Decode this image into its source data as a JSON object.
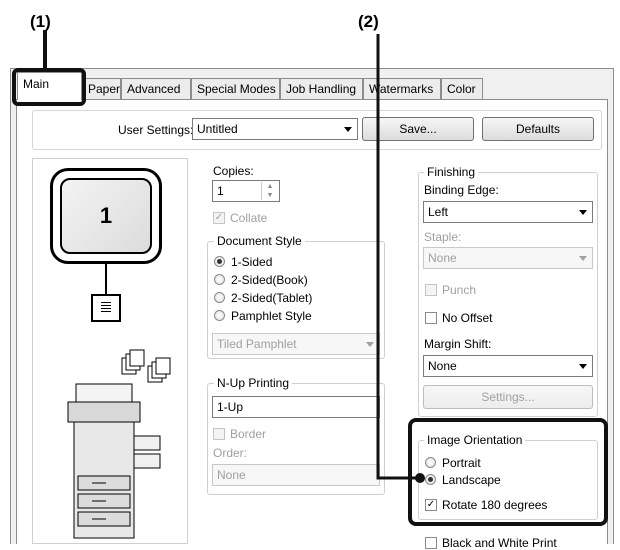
{
  "callouts": {
    "one": "(1)",
    "two": "(2)"
  },
  "tabs": [
    "Main",
    "Paper",
    "Advanced",
    "Special Modes",
    "Job Handling",
    "Watermarks",
    "Color"
  ],
  "user_settings": {
    "label": "User Settings:",
    "value": "Untitled",
    "save": "Save...",
    "defaults": "Defaults"
  },
  "preview": {
    "page_number": "1"
  },
  "copies": {
    "label": "Copies:",
    "value": "1",
    "collate": "Collate"
  },
  "document_style": {
    "legend": "Document Style",
    "options": [
      "1-Sided",
      "2-Sided(Book)",
      "2-Sided(Tablet)",
      "Pamphlet Style"
    ],
    "selected": "1-Sided",
    "pamphlet_value": "Tiled Pamphlet"
  },
  "nup": {
    "legend": "N-Up Printing",
    "value": "1-Up",
    "border": "Border",
    "order_label": "Order:",
    "order_value": "None"
  },
  "finishing": {
    "legend": "Finishing",
    "binding_label": "Binding Edge:",
    "binding_value": "Left",
    "staple_label": "Staple:",
    "staple_value": "None",
    "punch": "Punch",
    "no_offset": "No Offset",
    "margin_label": "Margin Shift:",
    "margin_value": "None",
    "settings": "Settings..."
  },
  "orientation": {
    "legend": "Image Orientation",
    "portrait": "Portrait",
    "landscape": "Landscape",
    "selected": "Landscape",
    "rotate": "Rotate 180 degrees",
    "rotate_checked": true
  },
  "bw_print": "Black and White Print"
}
